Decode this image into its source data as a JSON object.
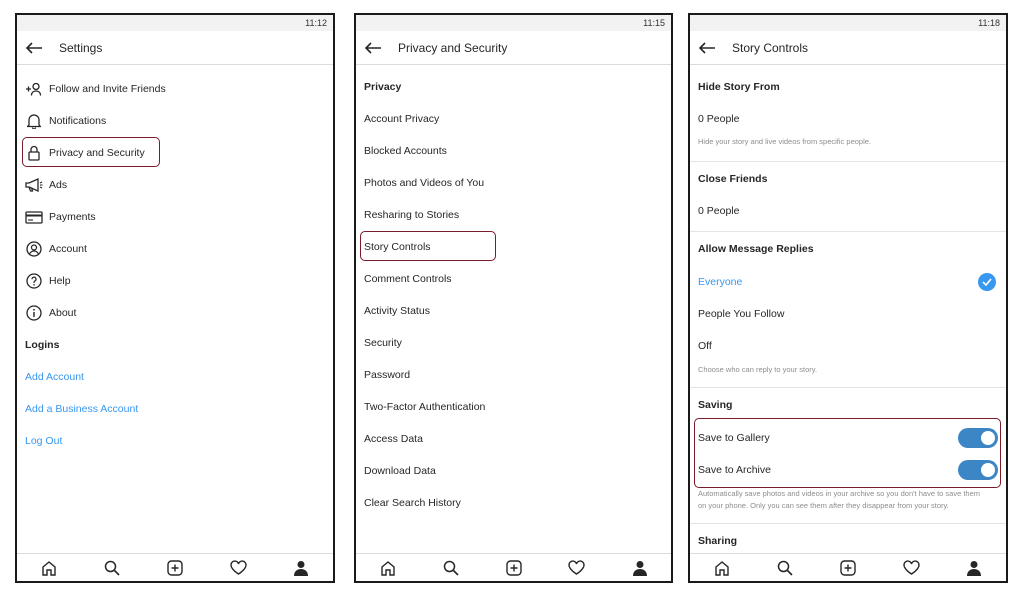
{
  "screen1": {
    "time": "11:12",
    "title": "Settings",
    "items": [
      {
        "label": "Follow and Invite Friends",
        "icon": "add-person-icon"
      },
      {
        "label": "Notifications",
        "icon": "bell-icon"
      },
      {
        "label": "Privacy and Security",
        "icon": "lock-icon"
      },
      {
        "label": "Ads",
        "icon": "megaphone-icon"
      },
      {
        "label": "Payments",
        "icon": "card-icon"
      },
      {
        "label": "Account",
        "icon": "account-icon"
      },
      {
        "label": "Help",
        "icon": "help-icon"
      },
      {
        "label": "About",
        "icon": "info-icon"
      }
    ],
    "logins_header": "Logins",
    "links": [
      "Add Account",
      "Add a Business Account",
      "Log Out"
    ]
  },
  "screen2": {
    "time": "11:15",
    "title": "Privacy and Security",
    "section_header": "Privacy",
    "items": [
      "Account Privacy",
      "Blocked Accounts",
      "Photos and Videos of You",
      "Resharing to Stories",
      "Story Controls",
      "Comment Controls",
      "Activity Status",
      "Security",
      "Password",
      "Two-Factor Authentication",
      "Access Data",
      "Download Data",
      "Clear Search History"
    ]
  },
  "screen3": {
    "time": "11:18",
    "title": "Story Controls",
    "hide_story_from": "Hide Story From",
    "hide_count": "0 People",
    "hide_desc": "Hide your story and live videos from specific people.",
    "close_friends": "Close Friends",
    "close_count": "0 People",
    "allow_replies": "Allow Message Replies",
    "reply_options": [
      "Everyone",
      "People You Follow",
      "Off"
    ],
    "reply_selected": "Everyone",
    "reply_desc": "Choose who can reply to your story.",
    "saving": "Saving",
    "save_gallery": "Save to Gallery",
    "save_gallery_on": true,
    "save_archive": "Save to Archive",
    "save_archive_on": true,
    "saving_desc_1": "Automatically save photos and videos in your archive so you don't have to save them",
    "saving_desc_2": "on your phone. Only you can see them after they disappear from your story.",
    "sharing": "Sharing"
  },
  "tabbar": [
    "home-icon",
    "search-icon",
    "add-post-icon",
    "heart-icon",
    "profile-icon"
  ],
  "colors": {
    "accent": "#3897f0",
    "toggle": "#3d86c6",
    "highlight": "#7a1b2a"
  }
}
